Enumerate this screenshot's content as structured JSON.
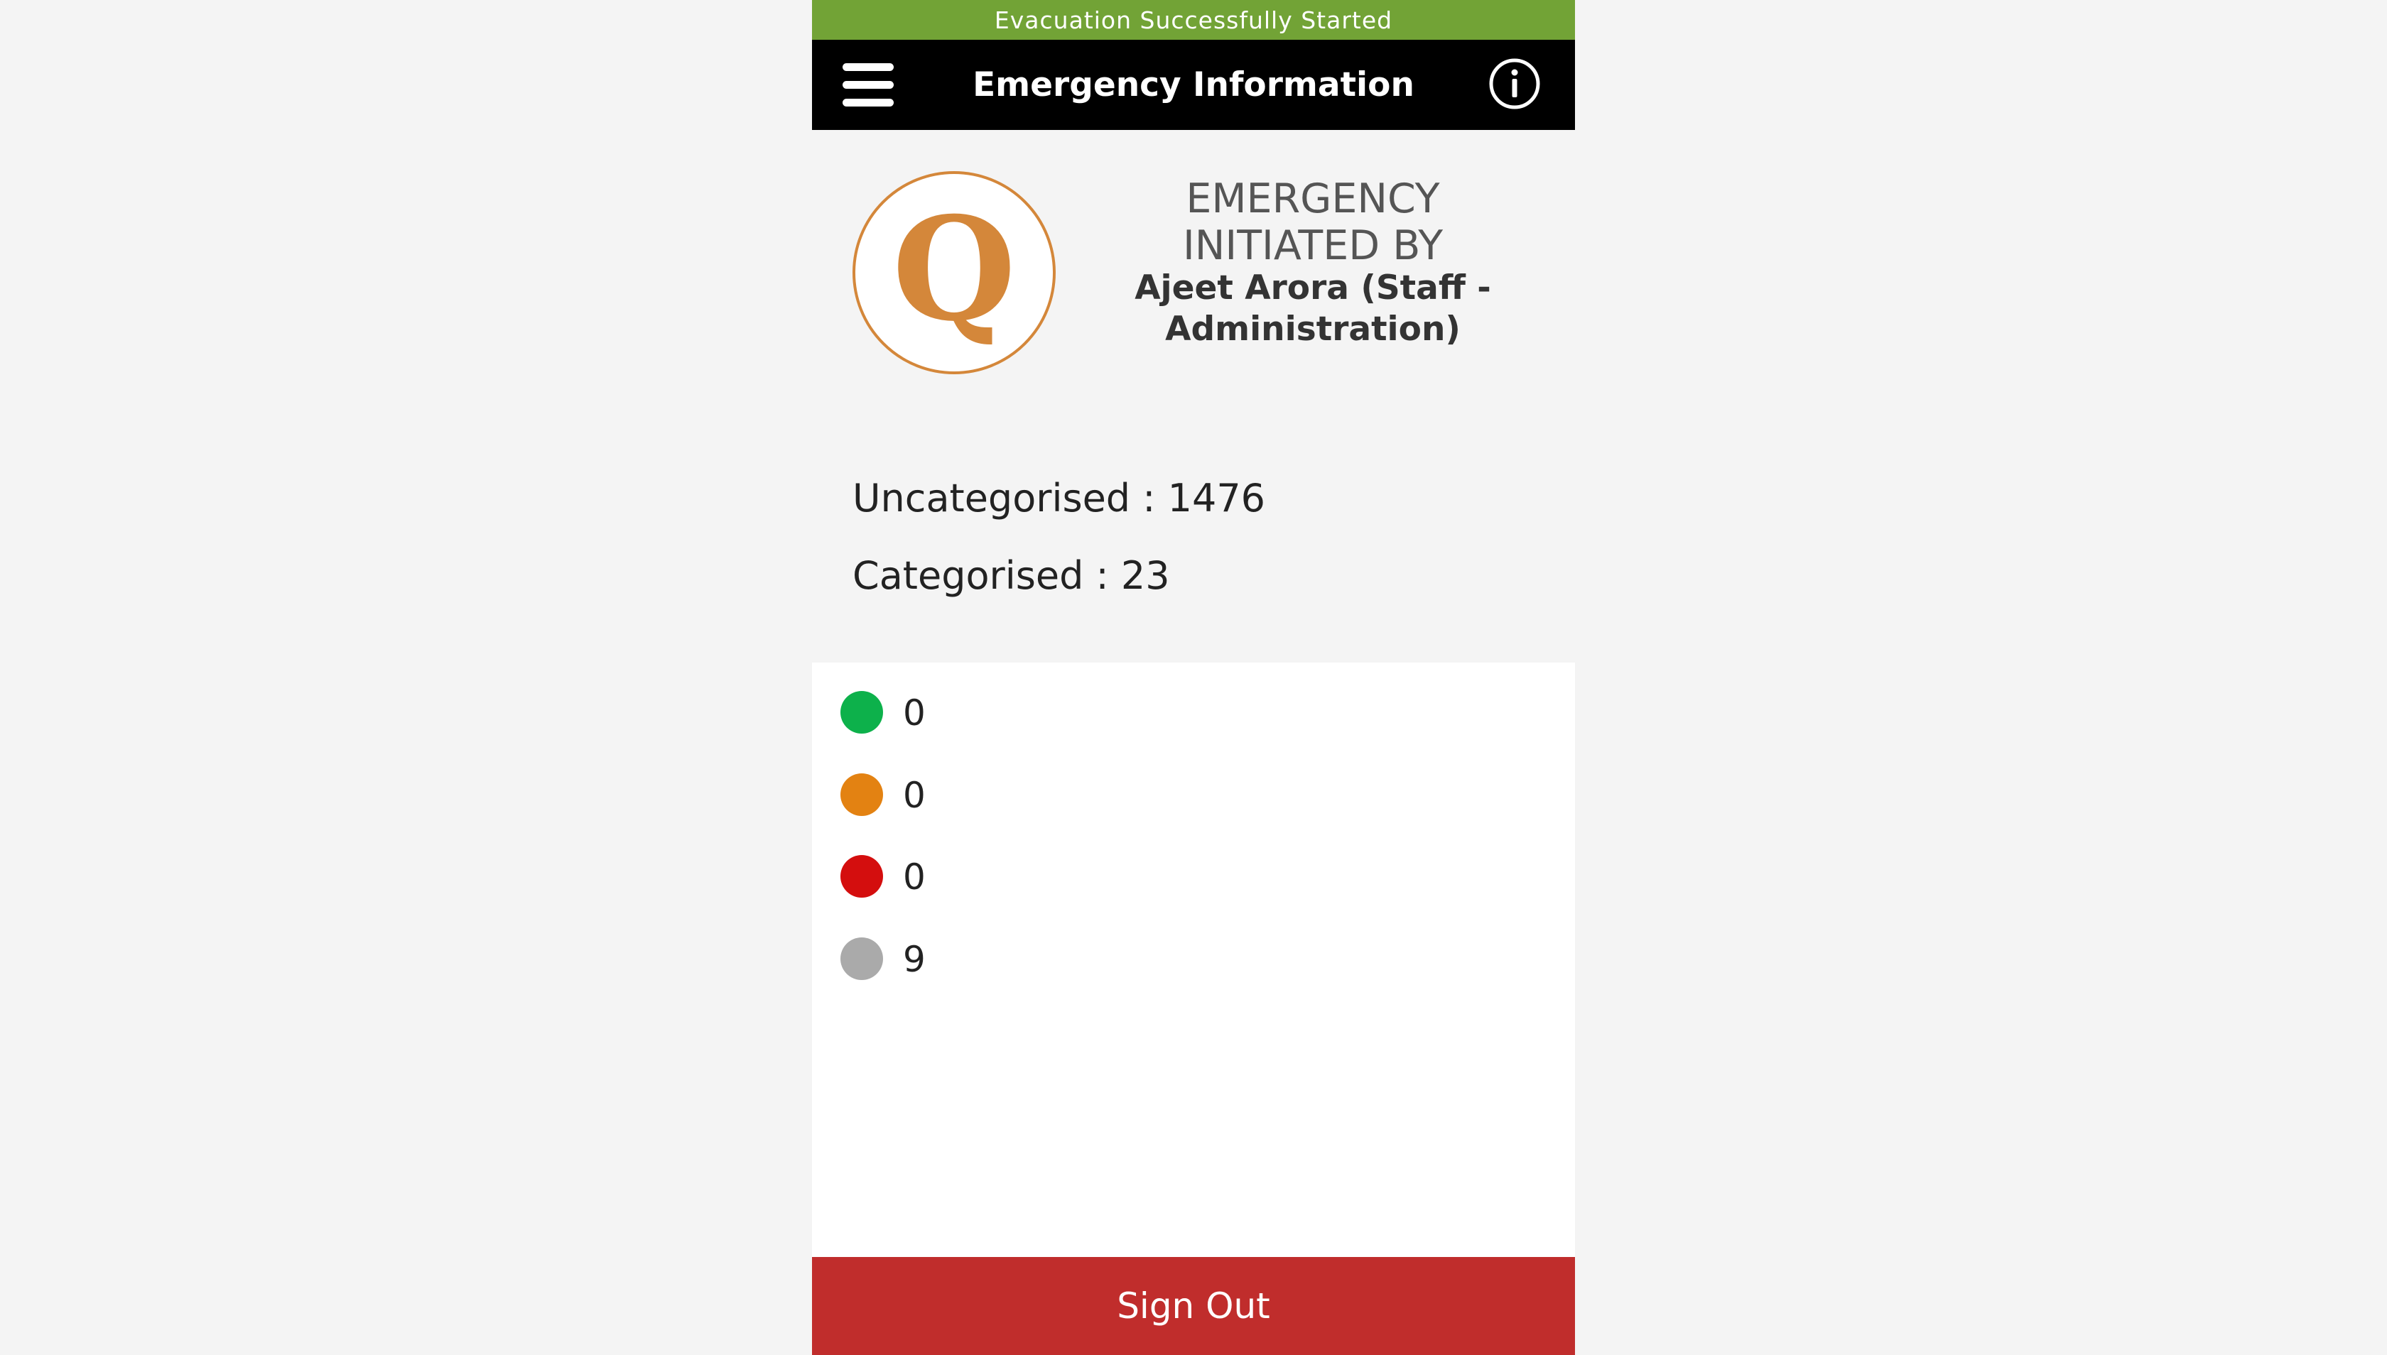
{
  "banner": {
    "text": "Evacuation Successfully Started",
    "color": "#72a336"
  },
  "navbar": {
    "title": "Emergency Information",
    "menu_icon": "hamburger-menu-icon",
    "info_icon": "info-circle-icon"
  },
  "header": {
    "logo_letter": "Q",
    "logo_color": "#d4873a",
    "heading_line1": "EMERGENCY",
    "heading_line2": "INITIATED BY",
    "initiator_line1": "Ajeet Arora (Staff -",
    "initiator_line2": "Administration)"
  },
  "counts": {
    "uncategorised_label": "Uncategorised",
    "uncategorised_value": "1476",
    "categorised_label": "Categorised",
    "categorised_value": "23",
    "separator": " : "
  },
  "statuses": [
    {
      "color": "#0db14b",
      "value": "0"
    },
    {
      "color": "#e38212",
      "value": "0"
    },
    {
      "color": "#d40e0e",
      "value": "0"
    },
    {
      "color": "#aaaaaa",
      "value": "9"
    }
  ],
  "signout": {
    "label": "Sign Out",
    "color": "#c02d2c"
  }
}
